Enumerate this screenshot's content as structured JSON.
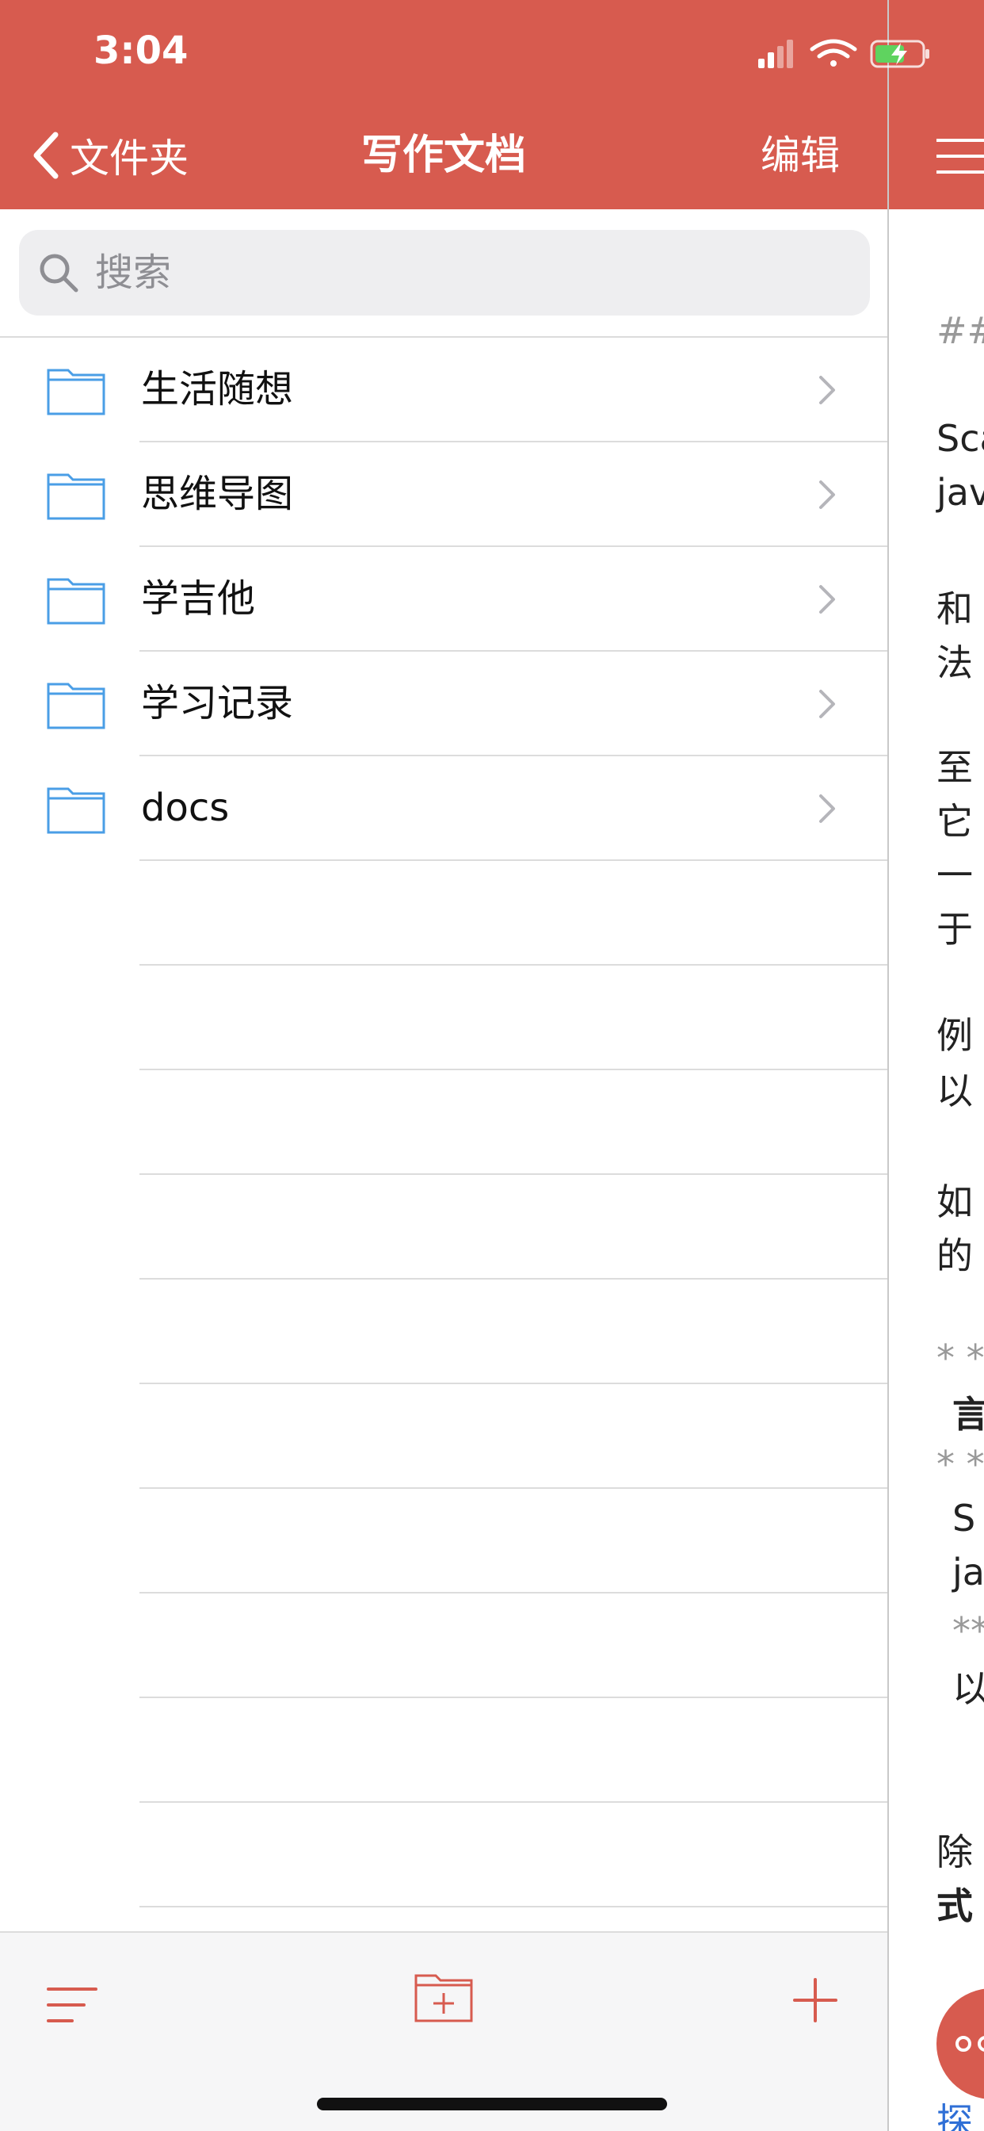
{
  "status_bar": {
    "time": "3:04"
  },
  "nav": {
    "back_label": "文件夹",
    "title": "写作文档",
    "edit_label": "编辑"
  },
  "search": {
    "placeholder": "搜索"
  },
  "folders": [
    {
      "name": "生活随想"
    },
    {
      "name": "思维导图"
    },
    {
      "name": "学吉他"
    },
    {
      "name": "学习记录"
    },
    {
      "name": "docs"
    }
  ],
  "preview": {
    "lines": [
      {
        "text": "##",
        "style": "gray"
      },
      {
        "text": "Sca",
        "style": "normal"
      },
      {
        "text": "jav",
        "style": "normal"
      },
      {
        "text": "和",
        "style": "normal"
      },
      {
        "text": "法",
        "style": "normal"
      },
      {
        "text": "至",
        "style": "normal"
      },
      {
        "text": "它",
        "style": "normal"
      },
      {
        "text": "一",
        "style": "normal"
      },
      {
        "text": "于",
        "style": "normal"
      },
      {
        "text": "例",
        "style": "normal"
      },
      {
        "text": "以",
        "style": "normal"
      },
      {
        "text": "如",
        "style": "normal"
      },
      {
        "text": "的",
        "style": "normal"
      },
      {
        "text": "* **",
        "style": "gray"
      },
      {
        "text": "言",
        "style": "bold"
      },
      {
        "text": "* **",
        "style": "gray"
      },
      {
        "text": "S",
        "style": "normal"
      },
      {
        "text": "ja",
        "style": "normal"
      },
      {
        "text": "**",
        "style": "gray"
      },
      {
        "text": "以",
        "style": "normal"
      },
      {
        "text": "除",
        "style": "normal"
      },
      {
        "text": "式",
        "style": "bold"
      },
      {
        "text": "探",
        "style": "link"
      }
    ]
  },
  "colors": {
    "accent": "#d75b4f",
    "folder_icon": "#4a9ee6",
    "separator": "#dcdcdc"
  }
}
